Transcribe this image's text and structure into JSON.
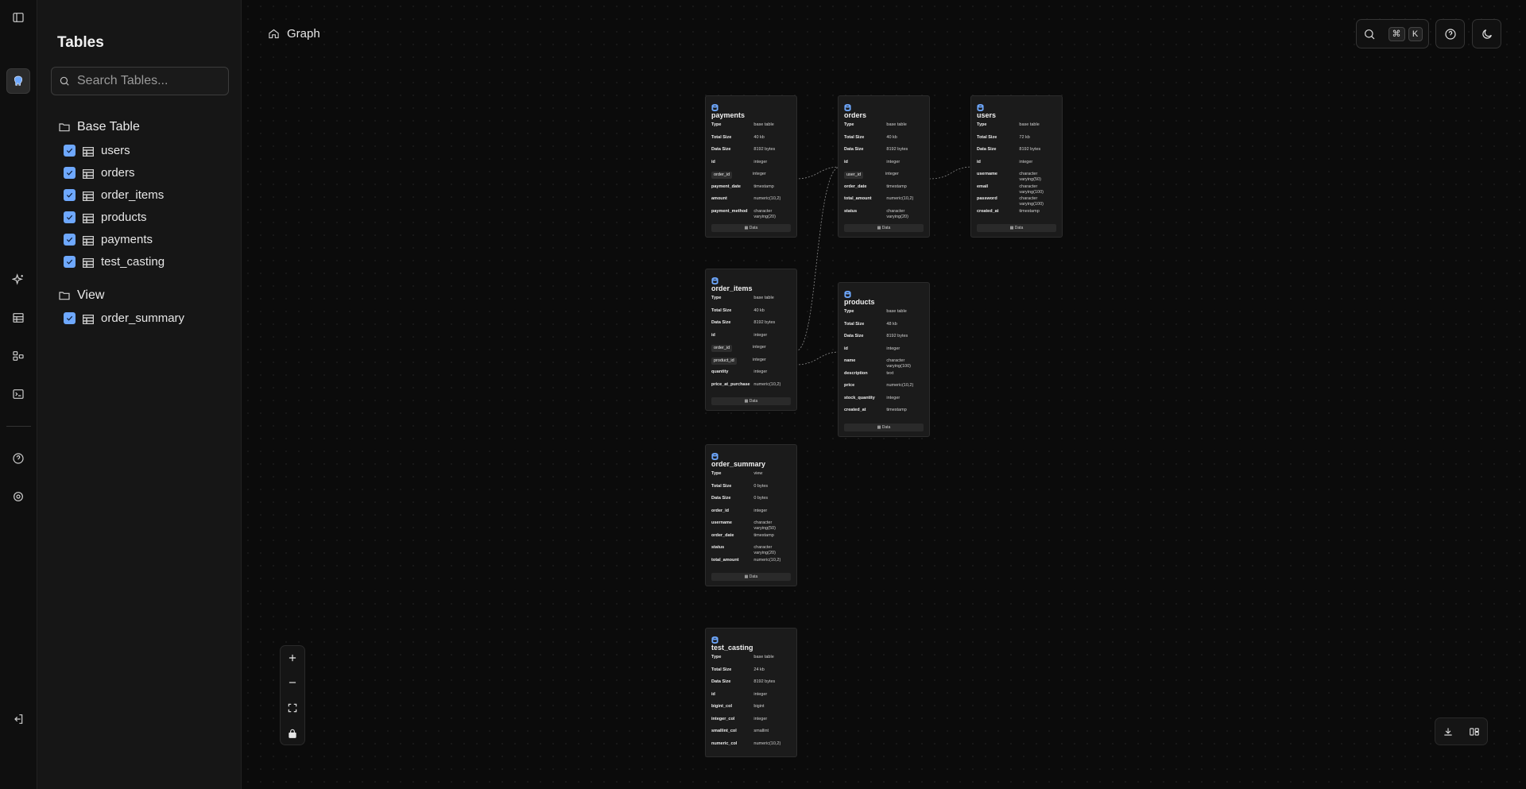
{
  "sidebar": {
    "title": "Tables",
    "search_placeholder": "Search Tables...",
    "groups": [
      {
        "label": "Base Table",
        "items": [
          "users",
          "orders",
          "order_items",
          "products",
          "payments",
          "test_casting"
        ]
      },
      {
        "label": "View",
        "items": [
          "order_summary"
        ]
      }
    ]
  },
  "breadcrumb": {
    "label": "Graph"
  },
  "search_shortcut": {
    "key1": "⌘",
    "key2": "K"
  },
  "accent_color": "#6ea8fe",
  "nodes": {
    "payments": {
      "name": "payments",
      "rows": [
        [
          "Type",
          "base table"
        ],
        [
          "Total Size",
          "40 kb"
        ],
        [
          "Data Size",
          "8192 bytes"
        ],
        [
          "id",
          "integer"
        ],
        [
          "order_id",
          "integer"
        ],
        [
          "payment_date",
          "timestamp"
        ],
        [
          "amount",
          "numeric(10,2)"
        ],
        [
          "payment_method",
          "character varying(20)"
        ]
      ],
      "data_label": "Data"
    },
    "orders": {
      "name": "orders",
      "rows": [
        [
          "Type",
          "base table"
        ],
        [
          "Total Size",
          "40 kb"
        ],
        [
          "Data Size",
          "8192 bytes"
        ],
        [
          "id",
          "integer"
        ],
        [
          "user_id",
          "integer"
        ],
        [
          "order_date",
          "timestamp"
        ],
        [
          "total_amount",
          "numeric(10,2)"
        ],
        [
          "status",
          "character varying(20)"
        ]
      ],
      "data_label": "Data"
    },
    "users": {
      "name": "users",
      "rows": [
        [
          "Type",
          "base table"
        ],
        [
          "Total Size",
          "72 kb"
        ],
        [
          "Data Size",
          "8192 bytes"
        ],
        [
          "id",
          "integer"
        ],
        [
          "username",
          "character varying(50)"
        ],
        [
          "email",
          "character varying(100)"
        ],
        [
          "password",
          "character varying(100)"
        ],
        [
          "created_at",
          "timestamp"
        ]
      ],
      "data_label": "Data"
    },
    "order_items": {
      "name": "order_items",
      "rows": [
        [
          "Type",
          "base table"
        ],
        [
          "Total Size",
          "40 kb"
        ],
        [
          "Data Size",
          "8192 bytes"
        ],
        [
          "id",
          "integer"
        ],
        [
          "order_id",
          "integer"
        ],
        [
          "product_id",
          "integer"
        ],
        [
          "quantity",
          "integer"
        ],
        [
          "price_at_purchase",
          "numeric(10,2)"
        ]
      ],
      "data_label": "Data"
    },
    "products": {
      "name": "products",
      "rows": [
        [
          "Type",
          "base table"
        ],
        [
          "Total Size",
          "48 kb"
        ],
        [
          "Data Size",
          "8192 bytes"
        ],
        [
          "id",
          "integer"
        ],
        [
          "name",
          "character varying(100)"
        ],
        [
          "description",
          "text"
        ],
        [
          "price",
          "numeric(10,2)"
        ],
        [
          "stock_quantity",
          "integer"
        ],
        [
          "created_at",
          "timestamp"
        ]
      ],
      "data_label": "Data"
    },
    "order_summary": {
      "name": "order_summary",
      "rows": [
        [
          "Type",
          "view"
        ],
        [
          "Total Size",
          "0 bytes"
        ],
        [
          "Data Size",
          "0 bytes"
        ],
        [
          "order_id",
          "integer"
        ],
        [
          "username",
          "character varying(50)"
        ],
        [
          "order_date",
          "timestamp"
        ],
        [
          "status",
          "character varying(20)"
        ],
        [
          "total_amount",
          "numeric(10,2)"
        ]
      ],
      "data_label": "Data"
    },
    "test_casting": {
      "name": "test_casting",
      "rows": [
        [
          "Type",
          "base table"
        ],
        [
          "Total Size",
          "24 kb"
        ],
        [
          "Data Size",
          "8192 bytes"
        ],
        [
          "id",
          "integer"
        ],
        [
          "bigint_col",
          "bigint"
        ],
        [
          "integer_col",
          "integer"
        ],
        [
          "smallint_col",
          "smallint"
        ],
        [
          "numeric_col",
          "numeric(10,2)"
        ]
      ]
    }
  }
}
